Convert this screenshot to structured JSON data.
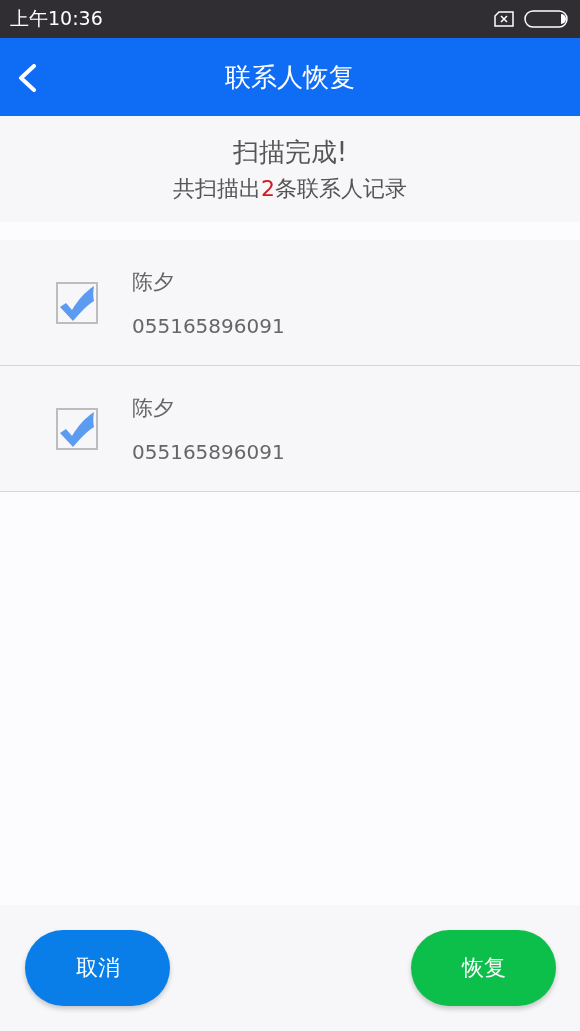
{
  "status_bar": {
    "time": "上午10:36"
  },
  "app_bar": {
    "title": "联系人恢复"
  },
  "scan_result": {
    "title": "扫描完成!",
    "summary_prefix": "共扫描出",
    "summary_count": "2",
    "summary_suffix": "条联系人记录"
  },
  "contacts": [
    {
      "name": "陈夕",
      "phone": "055165896091",
      "checked": true
    },
    {
      "name": "陈夕",
      "phone": "055165896091",
      "checked": true
    }
  ],
  "buttons": [
    {
      "label": "取消",
      "kind": "cancel"
    },
    {
      "label": "恢复",
      "kind": "confirm"
    }
  ]
}
